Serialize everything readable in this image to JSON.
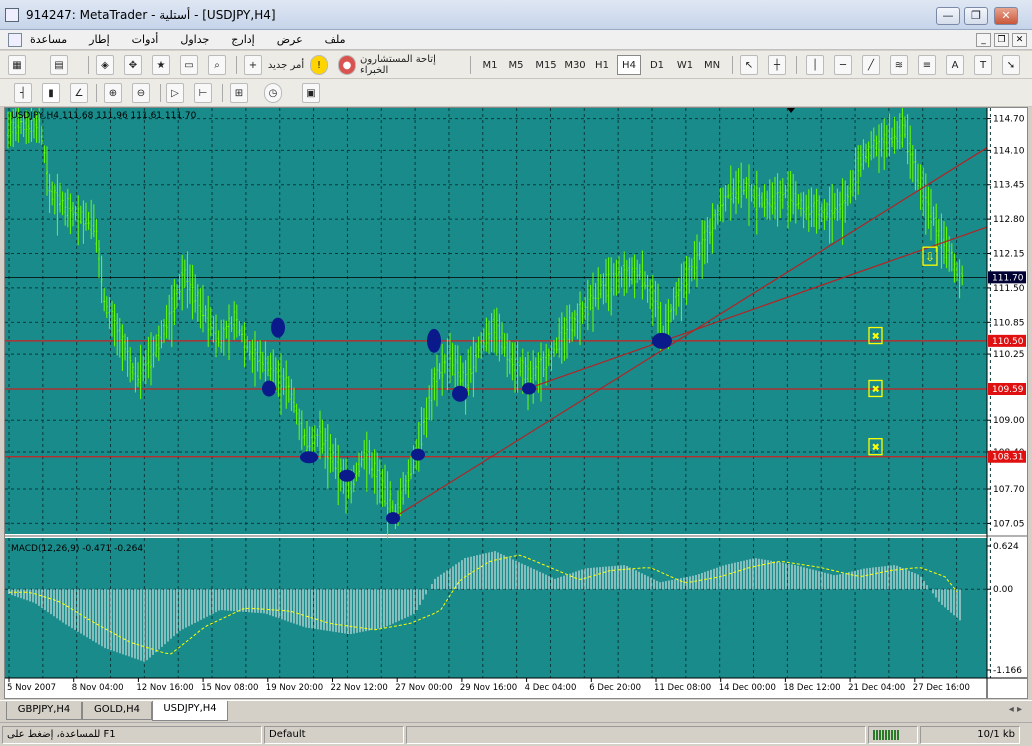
{
  "window": {
    "title": "914247: MetaTrader - أستلية - [USDJPY,H4]"
  },
  "menu": {
    "items": [
      "ملف",
      "عرض",
      "إدارج",
      "جداول",
      "أدوات",
      "إطار",
      "مساعدة"
    ]
  },
  "toolbar1": {
    "new_order": "أمر جديد",
    "experts": "إتاحة المستشارون الخبراء",
    "periods": [
      "M1",
      "M5",
      "M15",
      "M30",
      "H1",
      "H4",
      "D1",
      "W1",
      "MN"
    ],
    "active_period": "H4",
    "text_tool": "A"
  },
  "chart": {
    "header": "USDJPY,H4  111.68  111.96  111.61  111.70",
    "current_price_label": "111.70",
    "y_ticks": [
      "114.70",
      "114.10",
      "113.45",
      "112.80",
      "112.15",
      "111.50",
      "110.85",
      "110.25",
      "109.00",
      "108.40",
      "107.70",
      "107.05"
    ],
    "red_levels": [
      "110.50",
      "109.59",
      "108.31"
    ],
    "x_ticks": [
      "5 Nov 2007",
      "8 Nov 04:00",
      "12 Nov 16:00",
      "15 Nov 08:00",
      "19 Nov 20:00",
      "22 Nov 12:00",
      "27 Nov 00:00",
      "29 Nov 16:00",
      "4 Dec 04:00",
      "6 Dec 20:00",
      "11 Dec 08:00",
      "14 Dec 00:00",
      "18 Dec 12:00",
      "21 Dec 04:00",
      "27 Dec 16:00"
    ],
    "colors": {
      "background": "#1a8b8b",
      "grid": "#0b3a3a",
      "candles": "#66ff00",
      "support_lines": "#cc2020",
      "trendline": "#b02525",
      "markers": "#0a1a8a",
      "signals": "#ffff00",
      "macd_signal": "#ffff00",
      "macd_hist": "#f2f2f2"
    }
  },
  "macd": {
    "header": "MACD(12,26,9) -0.471 -0.264",
    "y_ticks": [
      "0.624",
      "0.00",
      "-1.166"
    ]
  },
  "tabs": [
    "GBPJPY,H4",
    "GOLD,H4",
    "USDJPY,H4"
  ],
  "active_tab": "USDJPY,H4",
  "status": {
    "help": "للمساعدة، إضغط على F1",
    "profile": "Default",
    "traffic": "10/1 kb"
  }
}
